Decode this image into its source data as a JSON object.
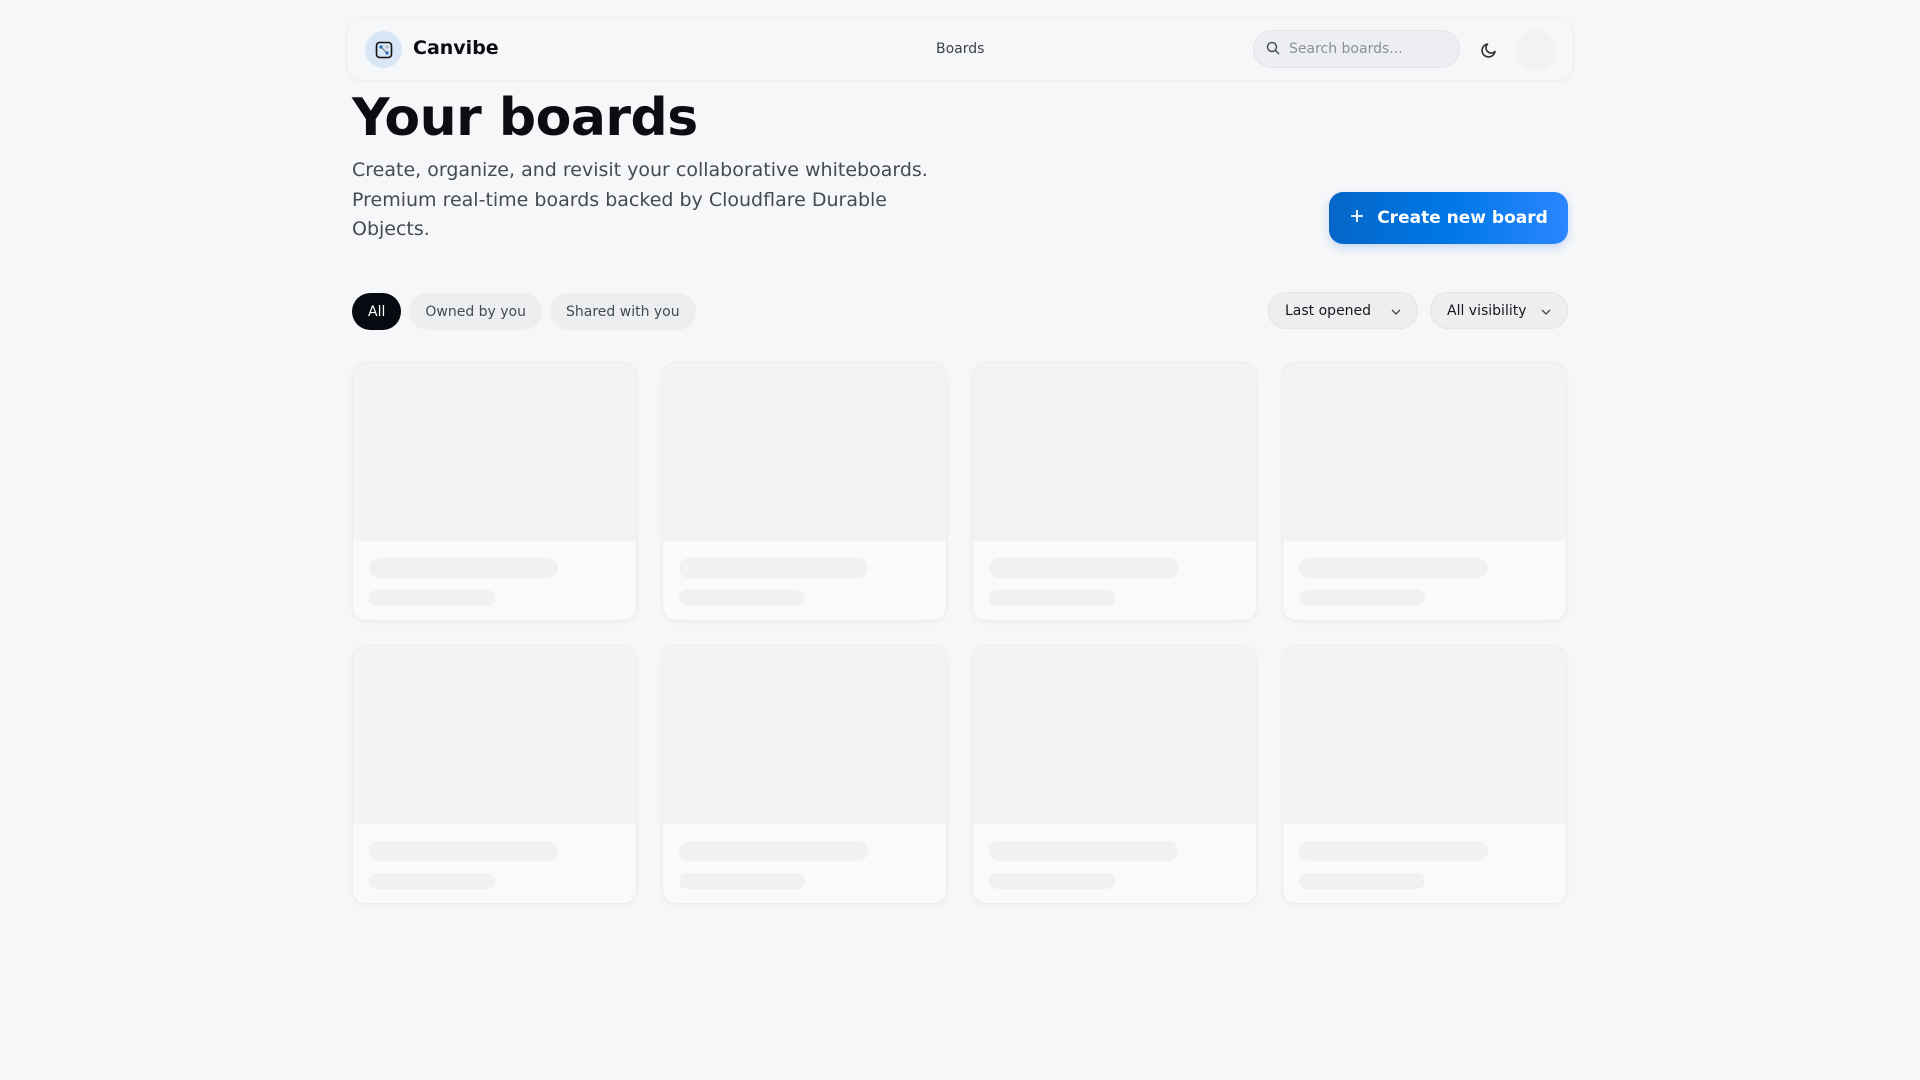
{
  "header": {
    "brand": "Canvibe",
    "nav_boards": "Boards",
    "search_placeholder": "Search boards..."
  },
  "main": {
    "title": "Your boards",
    "subtitle": "Create, organize, and revisit your collaborative whiteboards. Premium real-time boards backed by Cloudflare Durable Objects.",
    "create_label": "Create new board",
    "filters": [
      "All",
      "Owned by you",
      "Shared with you"
    ],
    "sort_value": "Last opened",
    "visibility_value": "All visibility"
  },
  "colors": {
    "accent": "#0077e6",
    "active_chip": "#070a10"
  }
}
